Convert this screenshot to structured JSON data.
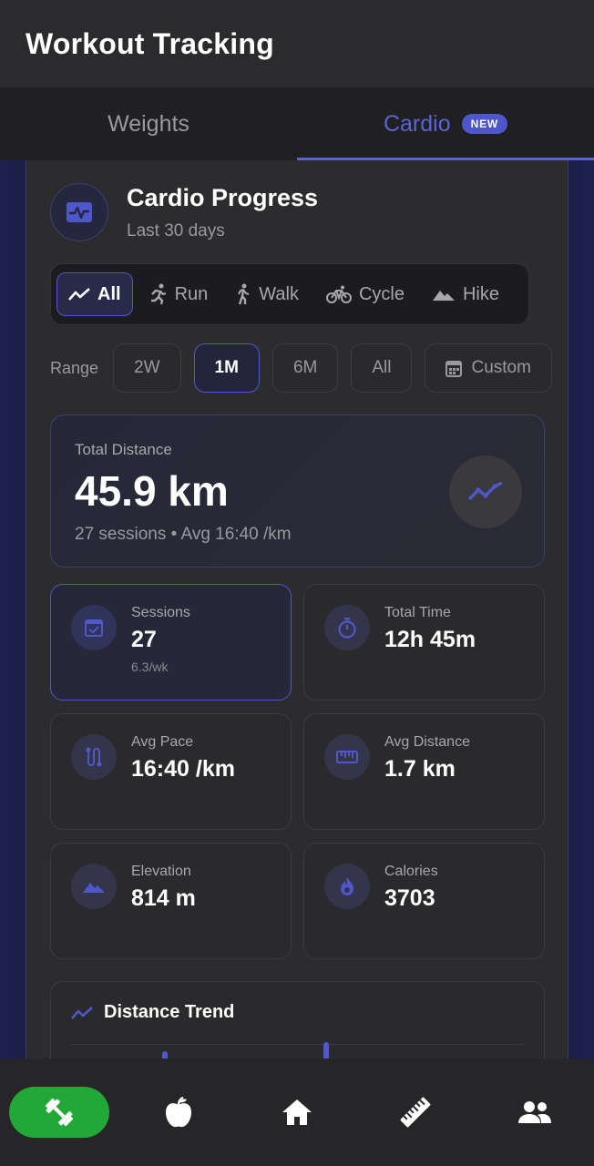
{
  "header": {
    "title": "Workout Tracking"
  },
  "tabs": [
    {
      "label": "Weights"
    },
    {
      "label": "Cardio",
      "badge": "NEW"
    }
  ],
  "card": {
    "title": "Cardio Progress",
    "subtitle": "Last 30 days",
    "icon": "heart-rate-monitor-icon"
  },
  "activity_types": [
    {
      "label": "All",
      "icon": "trend-line-icon",
      "selected": true
    },
    {
      "label": "Run",
      "icon": "running-icon"
    },
    {
      "label": "Walk",
      "icon": "walking-icon"
    },
    {
      "label": "Cycle",
      "icon": "bicycle-icon"
    },
    {
      "label": "Hike",
      "icon": "mountain-icon"
    }
  ],
  "range": {
    "label": "Range",
    "options": [
      "2W",
      "1M",
      "6M",
      "All",
      "Custom"
    ],
    "selected": "1M"
  },
  "total": {
    "label": "Total Distance",
    "value": "45.9 km",
    "sub": "27 sessions • Avg 16:40 /km"
  },
  "stats": [
    {
      "label": "Sessions",
      "value": "27",
      "sub": "6.3/wk",
      "icon": "calendar-check-icon"
    },
    {
      "label": "Total Time",
      "value": "12h 45m",
      "icon": "stopwatch-icon"
    },
    {
      "label": "Avg Pace",
      "value": "16:40 /km",
      "icon": "route-icon"
    },
    {
      "label": "Avg Distance",
      "value": "1.7 km",
      "icon": "ruler-icon"
    },
    {
      "label": "Elevation",
      "value": "814 m",
      "icon": "mountain-icon"
    },
    {
      "label": "Calories",
      "value": "3703",
      "icon": "flame-icon"
    }
  ],
  "trend": {
    "title": "Distance Trend"
  },
  "bottom_nav": [
    {
      "icon": "dumbbell-icon",
      "active": true
    },
    {
      "icon": "apple-icon"
    },
    {
      "icon": "home-icon"
    },
    {
      "icon": "ruler-icon"
    },
    {
      "icon": "people-icon"
    }
  ],
  "colors": {
    "accent": "#5058c9",
    "nav_active": "#22a837",
    "background": "#141416"
  }
}
